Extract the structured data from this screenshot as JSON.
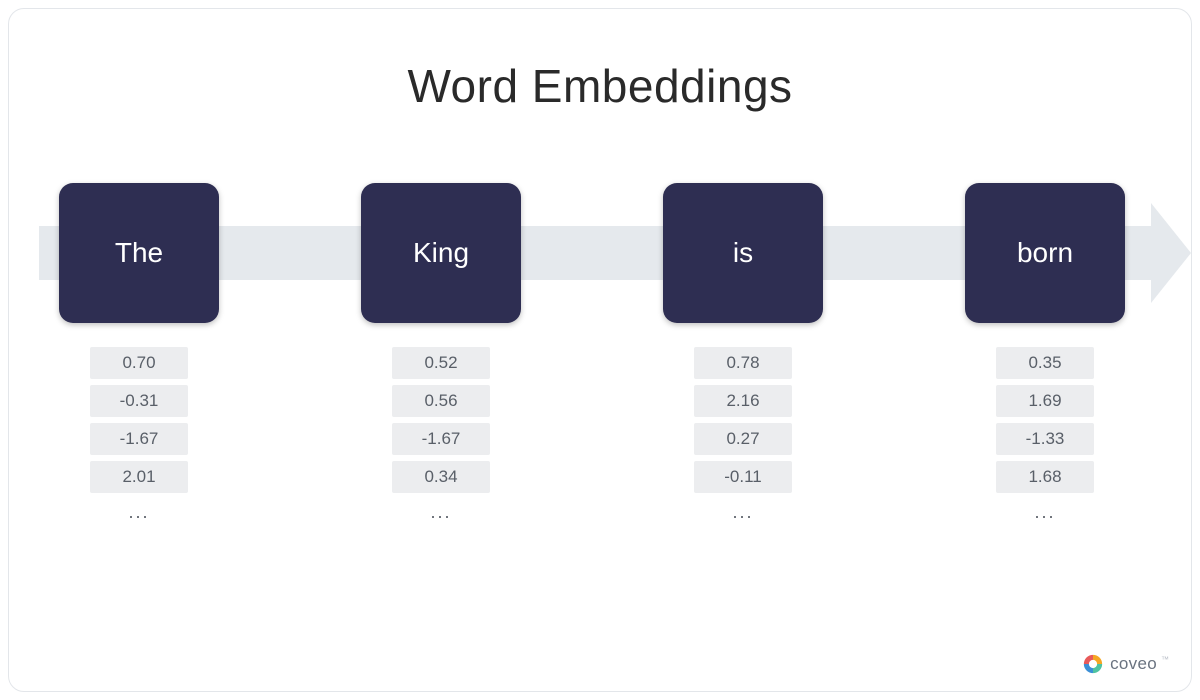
{
  "title": "Word Embeddings",
  "words": [
    {
      "label": "The",
      "vector": [
        "0.70",
        "-0.31",
        "-1.67",
        "2.01"
      ]
    },
    {
      "label": "King",
      "vector": [
        "0.52",
        "0.56",
        "-1.67",
        "0.34"
      ]
    },
    {
      "label": "is",
      "vector": [
        "0.78",
        "2.16",
        "0.27",
        "-0.11"
      ]
    },
    {
      "label": "born",
      "vector": [
        "0.35",
        "1.69",
        "-1.33",
        "1.68"
      ]
    }
  ],
  "ellipsis": "...",
  "brand": "coveo",
  "brand_tm": "™",
  "colors": {
    "box_bg": "#2e2e52",
    "arrow": "#e5e9ed",
    "cell_bg": "#ecedef",
    "cell_fg": "#595f68"
  }
}
